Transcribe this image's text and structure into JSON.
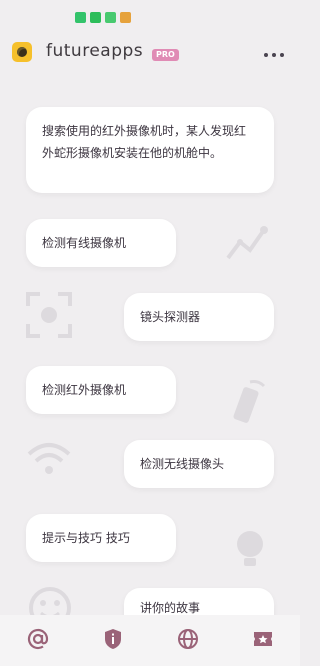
{
  "app": {
    "title": "futureapps",
    "badge": "PRO"
  },
  "header": {
    "menu_icon": "more-vert-icon"
  },
  "status_bar": {
    "icons": [
      "phone-icon",
      "wechat-icon",
      "messages-icon",
      "weibo-icon"
    ]
  },
  "cards": [
    {
      "text_line1": "搜索使用的红外摄像机时，某人发现红",
      "text_line2": "外蛇形摄像机安装在他的机舱中。"
    },
    {
      "label": "检测有线摄像机"
    },
    {
      "label": "镜头探测器"
    },
    {
      "label": "检测红外摄像机"
    },
    {
      "label": "检测无线摄像头"
    },
    {
      "label": "提示与技巧 技巧"
    },
    {
      "label": "讲你的故事"
    }
  ],
  "background_icons": [
    "trend-icon",
    "focus-icon",
    "remote-icon",
    "wifi-icon",
    "bulb-icon",
    "smiley-icon"
  ],
  "bottom_nav": [
    {
      "name": "at-icon"
    },
    {
      "name": "info-shield-icon"
    },
    {
      "name": "globe-icon"
    },
    {
      "name": "star-ticket-icon"
    }
  ],
  "colors": {
    "background": "#f0eef0",
    "accent": "#9a6378",
    "pro_badge": "#e08bb5",
    "logo": "#f6c02b"
  }
}
